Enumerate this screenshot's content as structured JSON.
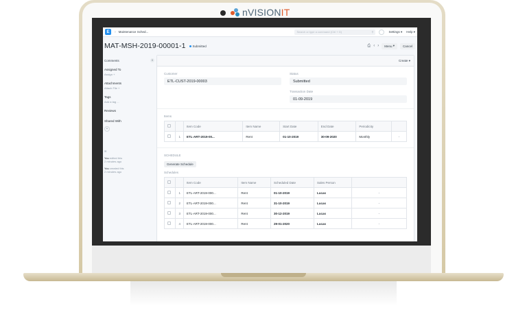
{
  "brand": {
    "prefix": "n",
    "name": "VISION",
    "suffix": "IT"
  },
  "navbar": {
    "logo": "E",
    "breadcrumb": "Maintenance Sched...",
    "search_placeholder": "Search or type a command (Ctrl + G)",
    "settings": "Settings",
    "help": "Help"
  },
  "page": {
    "title": "MAT-MSH-2019-00001-1",
    "status": "Submitted",
    "menu": "Menu",
    "cancel": "Cancel",
    "create": "Create"
  },
  "sidebar": {
    "comments": "Comments",
    "comments_count": "0",
    "assigned_to": "Assigned To",
    "assign": "Assign",
    "attachments": "Attachments",
    "attach_file": "Attach File",
    "tags": "Tags",
    "add_tag": "Add a tag ...",
    "reviews": "Reviews",
    "shared_with": "Shared With",
    "activity": [
      {
        "who": "You",
        "text": "edited this",
        "when": "2 minutes ago"
      },
      {
        "who": "You",
        "text": "created this",
        "when": "2 minutes ago"
      }
    ]
  },
  "form": {
    "customer_label": "Customer",
    "customer": "ETL-CUST-2019-00003",
    "status_label": "Status",
    "status": "Submitted",
    "txn_date_label": "Transaction Date",
    "txn_date": "01-09-2019",
    "items_label": "Items",
    "schedule_section": "SCHEDULE",
    "generate_schedule": "Generate Schedule",
    "schedules_label": "Schedules"
  },
  "items_table": {
    "headers": [
      "Item Code",
      "Item Name",
      "Start Date",
      "End Date",
      "Periodicity"
    ],
    "rows": [
      {
        "idx": "1",
        "code": "ETL-ART-2019-00...",
        "name": "Rent",
        "start": "01-10-2019",
        "end": "30-09-2020",
        "periodicity": "Monthly"
      }
    ]
  },
  "schedules_table": {
    "headers": [
      "Item Code",
      "Item Name",
      "Scheduled Date",
      "Sales Person"
    ],
    "rows": [
      {
        "idx": "1",
        "code": "ETL-ART-2019-000...",
        "name": "Rent",
        "date": "01-10-2019",
        "person": "Lucas"
      },
      {
        "idx": "2",
        "code": "ETL-ART-2019-000...",
        "name": "Rent",
        "date": "31-10-2019",
        "person": "Lucas"
      },
      {
        "idx": "3",
        "code": "ETL-ART-2019-000...",
        "name": "Rent",
        "date": "30-12-2019",
        "person": "Lucas"
      },
      {
        "idx": "4",
        "code": "ETL-ART-2019-000...",
        "name": "Rent",
        "date": "29-01-2020",
        "person": "Lucas"
      }
    ]
  },
  "colors": {
    "primary": "#2490ef",
    "frame_gold": "#d6c9a6",
    "brand_orange": "#e05a2a"
  }
}
